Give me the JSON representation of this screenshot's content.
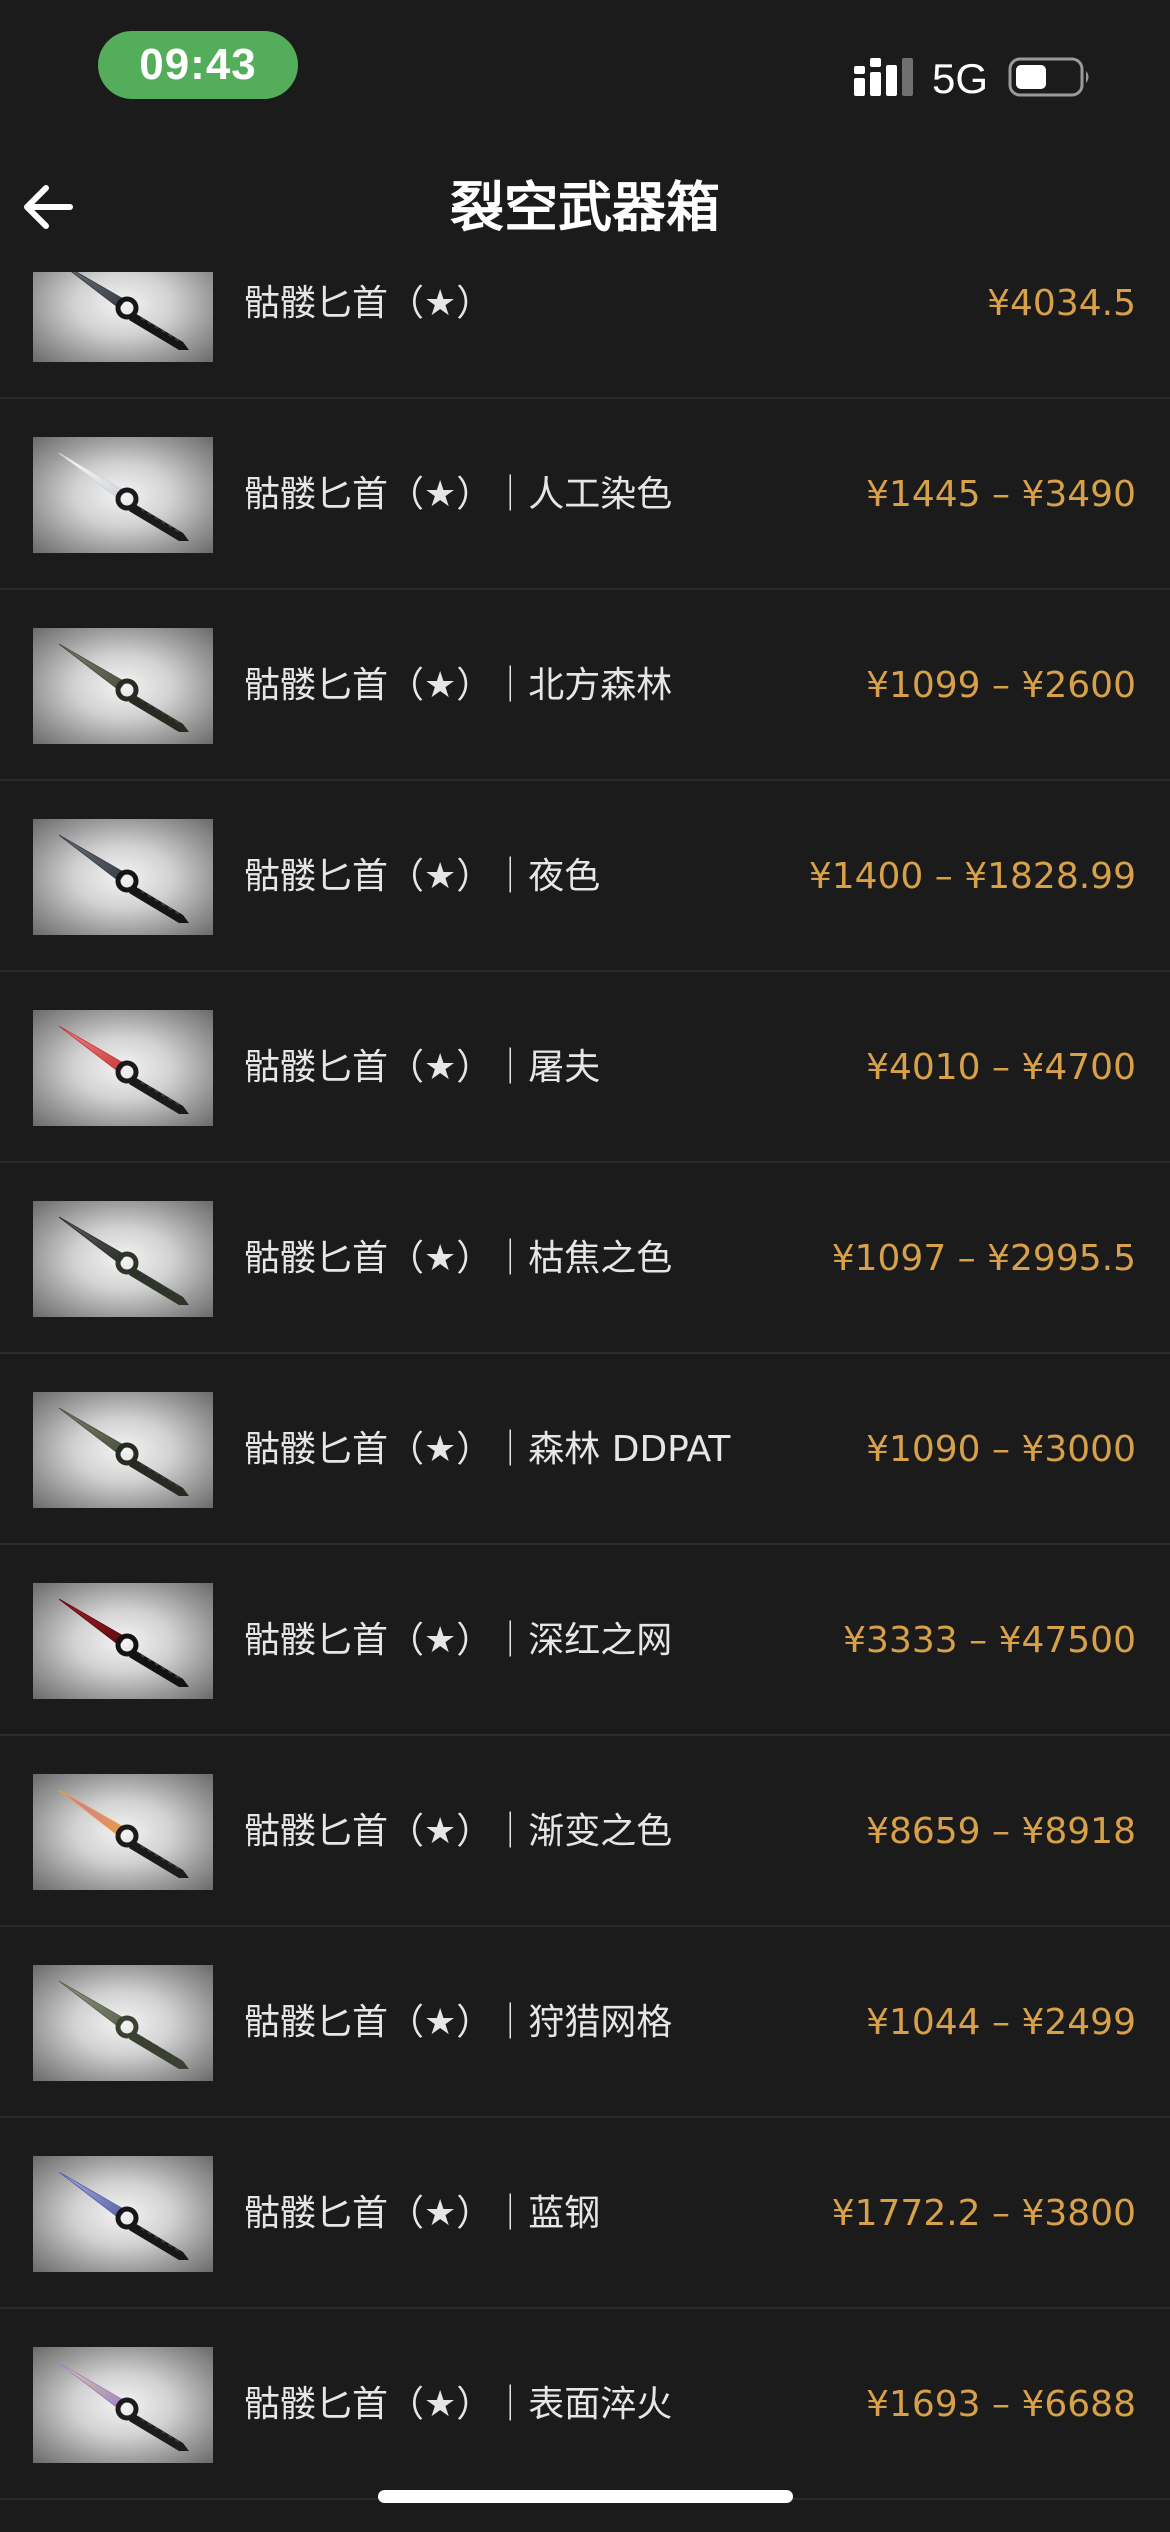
{
  "status_bar": {
    "time": "09:43",
    "network": "5G",
    "battery_level": 0.5
  },
  "nav": {
    "back_icon": "arrow-left-icon",
    "title": "裂空武器箱"
  },
  "colors": {
    "background": "#1b1b1c",
    "price": "#d8a048",
    "time_pill": "#53ad5a"
  },
  "items": [
    {
      "name": "骷髅匕首（★）",
      "price": "¥4034.5",
      "finish": "night"
    },
    {
      "name": "骷髅匕首（★）｜人工染色",
      "price": "¥1445 – ¥3490",
      "finish": "stained"
    },
    {
      "name": "骷髅匕首（★）｜北方森林",
      "price": "¥1099 – ¥2600",
      "finish": "forest"
    },
    {
      "name": "骷髅匕首（★）｜夜色",
      "price": "¥1400 – ¥1828.99",
      "finish": "night"
    },
    {
      "name": "骷髅匕首（★）｜屠夫",
      "price": "¥4010 – ¥4700",
      "finish": "slaughter"
    },
    {
      "name": "骷髅匕首（★）｜枯焦之色",
      "price": "¥1097 – ¥2995.5",
      "finish": "scorched"
    },
    {
      "name": "骷髅匕首（★）｜森林 DDPAT",
      "price": "¥1090 – ¥3000",
      "finish": "forest"
    },
    {
      "name": "骷髅匕首（★）｜深红之网",
      "price": "¥3333 – ¥47500",
      "finish": "crimson"
    },
    {
      "name": "骷髅匕首（★）｜渐变之色",
      "price": "¥8659 – ¥8918",
      "finish": "fade"
    },
    {
      "name": "骷髅匕首（★）｜狩猎网格",
      "price": "¥1044 – ¥2499",
      "finish": "safari"
    },
    {
      "name": "骷髅匕首（★）｜蓝钢",
      "price": "¥1772.2 – ¥3800",
      "finish": "blue"
    },
    {
      "name": "骷髅匕首（★）｜表面淬火",
      "price": "¥1693 – ¥6688",
      "finish": "case"
    }
  ]
}
